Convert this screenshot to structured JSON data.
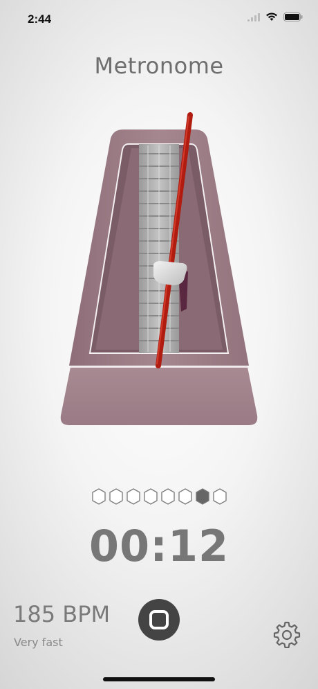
{
  "status_bar": {
    "time": "2:44",
    "icons": [
      "signal-icon",
      "wifi-icon",
      "battery-icon"
    ]
  },
  "app": {
    "title": "Metronome"
  },
  "beats": {
    "total": 8,
    "active_index": 6,
    "active_color": "#666666",
    "inactive_color": "#ffffff"
  },
  "timer": {
    "elapsed": "00:12"
  },
  "tempo": {
    "bpm_label": "185 BPM",
    "name": "Very fast"
  },
  "controls": {
    "stop_icon": "stop-icon",
    "settings_icon": "gear-icon"
  },
  "colors": {
    "metronome_body": "#a0808a",
    "pendulum": "#b01c10",
    "scale": "#a9a9a9"
  }
}
